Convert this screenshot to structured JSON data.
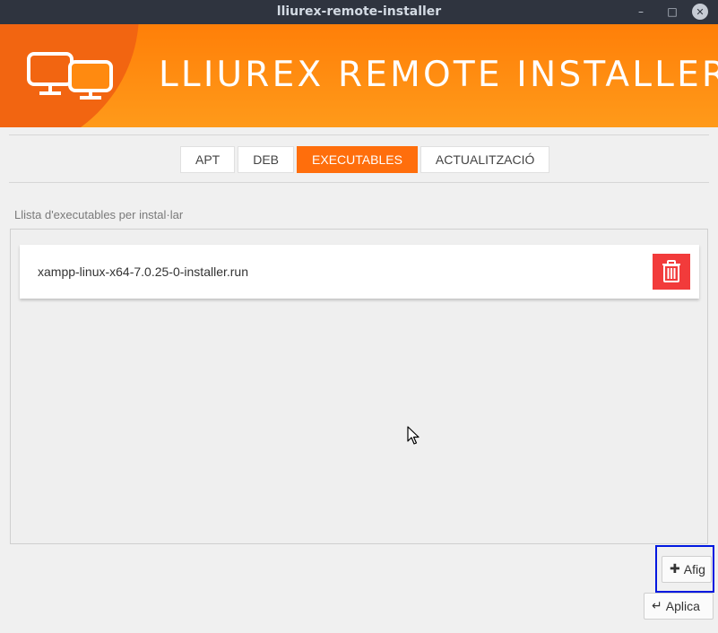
{
  "window": {
    "title": "lliurex-remote-installer",
    "minimize_glyph": "–",
    "maximize_glyph": "□",
    "close_glyph": "✕"
  },
  "banner": {
    "title": "LLIUREX REMOTE INSTALLER",
    "logo_icon": "monitors-icon",
    "colors": {
      "gradient_start": "#ff7f08",
      "gradient_end": "#ff9a1a",
      "circle": "#f26511"
    }
  },
  "tabs": [
    {
      "label": "APT",
      "active": false
    },
    {
      "label": "DEB",
      "active": false
    },
    {
      "label": "EXECUTABLES",
      "active": true
    },
    {
      "label": "ACTUALITZACIÓ",
      "active": false
    }
  ],
  "list": {
    "label": "Llista d'executables per instal·lar",
    "items": [
      {
        "name": "xampp-linux-x64-7.0.25-0-installer.run",
        "action_icon": "trash-icon"
      }
    ]
  },
  "buttons": {
    "add_label": "Afig",
    "add_icon": "plus-icon",
    "apply_label": "Aplica",
    "apply_icon": "enter-icon"
  },
  "colors": {
    "accent": "#ff6e0c",
    "delete": "#f23b3b",
    "focus_ring": "#0018e0"
  }
}
